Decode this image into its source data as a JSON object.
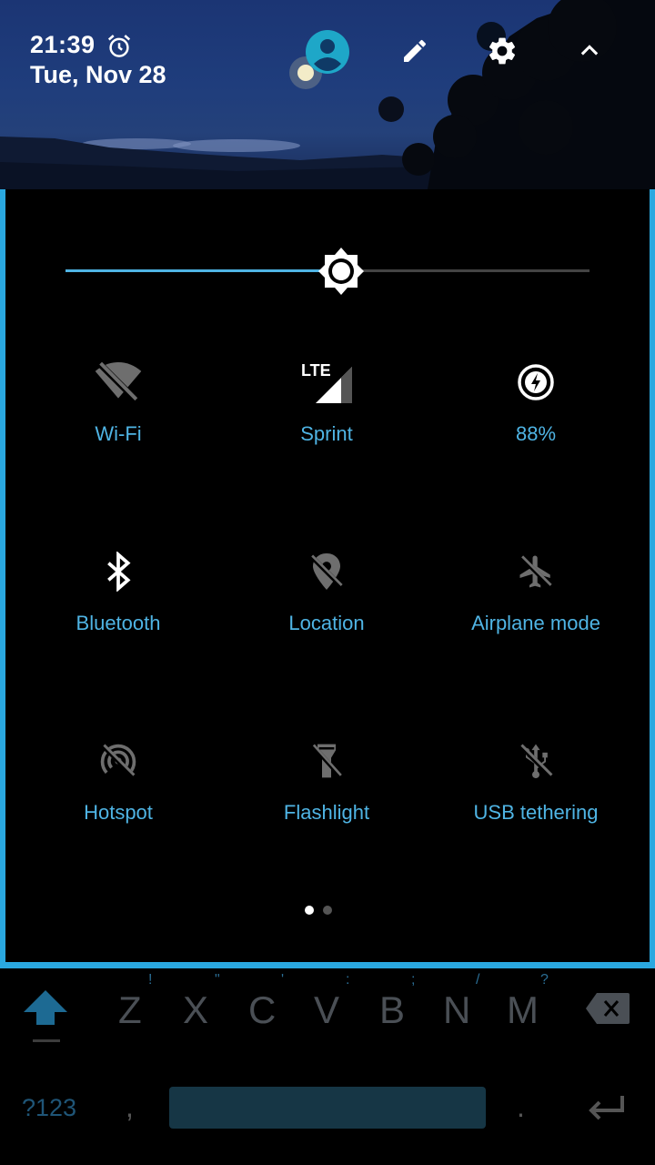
{
  "status": {
    "time": "21:39",
    "date": "Tue, Nov 28"
  },
  "header_icons": [
    "alarm-icon",
    "user-icon",
    "edit-icon",
    "settings-icon",
    "collapse-chevron-icon"
  ],
  "brightness": {
    "level_fraction": 0.53
  },
  "tiles": [
    {
      "label": "Wi-Fi",
      "icon": "wifi-off-icon",
      "active": false
    },
    {
      "label": "Sprint",
      "icon": "cellular-lte-icon",
      "network_type": "LTE",
      "active": true
    },
    {
      "label": "88%",
      "icon": "battery-saver-icon",
      "active": true
    },
    {
      "label": "Bluetooth",
      "icon": "bluetooth-icon",
      "active": true
    },
    {
      "label": "Location",
      "icon": "location-off-icon",
      "active": false
    },
    {
      "label": "Airplane mode",
      "icon": "airplane-off-icon",
      "active": false
    },
    {
      "label": "Hotspot",
      "icon": "hotspot-off-icon",
      "active": false
    },
    {
      "label": "Flashlight",
      "icon": "flashlight-off-icon",
      "active": false
    },
    {
      "label": "USB tethering",
      "icon": "usb-off-icon",
      "active": false
    }
  ],
  "pager": {
    "pages": 2,
    "current": 1
  },
  "keyboard": {
    "letters": [
      "Z",
      "X",
      "C",
      "V",
      "B",
      "N",
      "M"
    ],
    "hints": [
      "!",
      "\"",
      "'",
      ":",
      ";",
      "/",
      "?"
    ],
    "symbols_key": "?123",
    "comma": ",",
    "period": "."
  },
  "colors": {
    "accent": "#4fb4e4",
    "panel_border": "#2aa8e0",
    "inactive_icon": "#6e6e6e"
  }
}
